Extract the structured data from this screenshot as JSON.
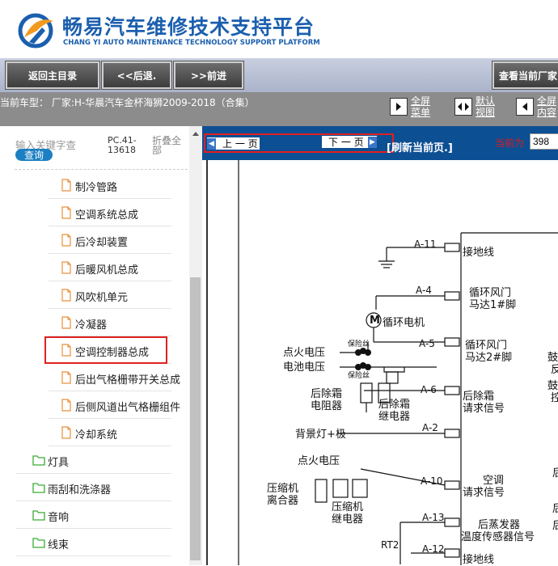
{
  "brand": {
    "name_cn": "畅易汽车维修技术支持平台",
    "name_en": "CHANG YI AUTO MAINTENANCE TECHNOLOGY SUPPORT PLATFORM"
  },
  "navbar": {
    "home": "返回主目录",
    "back": "<<后退.",
    "forward": ">>前进",
    "view_current": "查看当前厂家"
  },
  "infobar": {
    "current_model": "当前车型：  厂家:H-华晨汽车金杯海狮2009-2018（合集）",
    "full_menu_line1": "全屏",
    "full_menu_line2": "菜单",
    "default_view_line1": "默认",
    "default_view_line2": "视图",
    "full_content_line1": "全屏",
    "full_content_line2": "内容"
  },
  "search": {
    "placeholder": "输入关键字查",
    "button": "查询",
    "page_code": "PC.41-13618",
    "collapse_all": "折叠全部"
  },
  "tree": {
    "items": [
      {
        "label": "制冷管路",
        "type": "doc"
      },
      {
        "label": "空调系统总成",
        "type": "doc"
      },
      {
        "label": "后冷却装置",
        "type": "doc"
      },
      {
        "label": "后暖风机总成",
        "type": "doc"
      },
      {
        "label": "风吹机单元",
        "type": "doc"
      },
      {
        "label": "冷凝器",
        "type": "doc"
      },
      {
        "label": "空调控制器总成",
        "type": "doc",
        "highlighted": true
      },
      {
        "label": "后出气格栅带开关总成",
        "type": "doc"
      },
      {
        "label": "后侧风道出气格栅组件",
        "type": "doc"
      },
      {
        "label": "冷却系统",
        "type": "doc"
      },
      {
        "label": "灯具",
        "type": "folder"
      },
      {
        "label": "雨刮和洗涤器",
        "type": "folder"
      },
      {
        "label": "音响",
        "type": "folder"
      },
      {
        "label": "线束",
        "type": "folder"
      }
    ]
  },
  "pagenav": {
    "prev": "上 一 页",
    "next": "下 一 页",
    "refresh": "[刷新当前页.]",
    "current_page_label": "当前为",
    "current_page": "398"
  },
  "diagram": {
    "pins": [
      "A-11",
      "A-4",
      "A-5",
      "A-6",
      "A-2",
      "A-10",
      "A-13",
      "A-12"
    ],
    "labels": {
      "ground1": "接地线",
      "recirc1_l1": "循环风门",
      "recirc1_l2": "马达1#脚",
      "motor": "循环电机",
      "motor_symbol": "M",
      "fuse1": "保险丝",
      "fuse2": "保险丝",
      "ignition": "点火电压",
      "battery": "电池电压",
      "recirc2_l1": "循环风门",
      "recirc2_l2": "马达2#脚",
      "defrost_res_l1": "后除霜",
      "defrost_res_l2": "电阻器",
      "defrost_relay_l1": "后除霜",
      "defrost_relay_l2": "继电器",
      "defrost_req_l1": "后除霜",
      "defrost_req_l2": "请求信号",
      "backlight": "背景灯+极",
      "ignition2": "点火电压",
      "clutch_l1": "压缩机",
      "clutch_l2": "离合器",
      "comp_relay_l1": "压缩机",
      "comp_relay_l2": "继电器",
      "ac_req_l1": "空调",
      "ac_req_l2": "请求信号",
      "evap_l1": "后蒸发器",
      "evap_l2": "温度传感器信号",
      "rt2": "RT2",
      "ground2": "接地线",
      "right1": "鼓",
      "right2": "反",
      "right3": "鼓",
      "right4": "控",
      "right5": "后",
      "right6": "后",
      "right7": "后"
    }
  },
  "colors": {
    "brand_blue": "#1b5fae",
    "page_nav_bg": "#0c4f93",
    "highlight_red": "#e02020",
    "current_page_red": "#e01a1a",
    "folder_green": "#3aaa35",
    "doc_orange": "#e8913a"
  }
}
